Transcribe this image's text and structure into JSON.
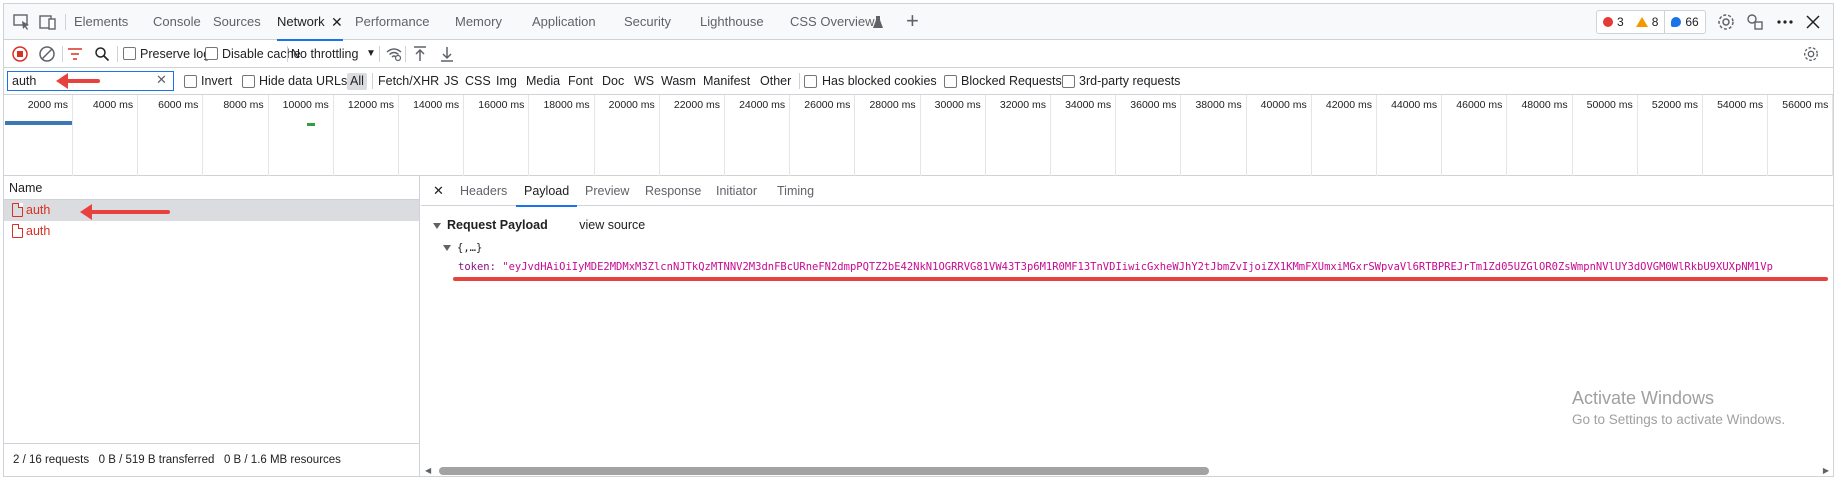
{
  "tabbar": {
    "tabs": [
      "Elements",
      "Console",
      "Sources",
      "Network",
      "Performance",
      "Memory",
      "Application",
      "Security",
      "Lighthouse",
      "CSS Overview"
    ],
    "active_tab": "Network",
    "close_glyph": "✕",
    "plus_glyph": "+",
    "error_count": "3",
    "warning_count": "8",
    "message_count": "66",
    "icons": [
      "inspect-element-icon",
      "device-toolbar-icon",
      "settings-gear-icon",
      "customize-icon",
      "more-options-icon",
      "close-devtools-icon"
    ]
  },
  "toolbar": {
    "preserve_log": "Preserve log",
    "disable_cache": "Disable cache",
    "throttling": "No throttling",
    "dropdown_glyph": "▼"
  },
  "filter": {
    "value": "auth",
    "clear_glyph": "✕",
    "invert": "Invert",
    "hide_data_urls": "Hide data URLs",
    "types": [
      "All",
      "Fetch/XHR",
      "JS",
      "CSS",
      "Img",
      "Media",
      "Font",
      "Doc",
      "WS",
      "Wasm",
      "Manifest",
      "Other"
    ],
    "has_blocked_cookies": "Has blocked cookies",
    "blocked_requests": "Blocked Requests",
    "third_party": "3rd-party requests"
  },
  "timeline": {
    "ticks": [
      "2000 ms",
      "4000 ms",
      "6000 ms",
      "8000 ms",
      "10000 ms",
      "12000 ms",
      "14000 ms",
      "16000 ms",
      "18000 ms",
      "20000 ms",
      "22000 ms",
      "24000 ms",
      "26000 ms",
      "28000 ms",
      "30000 ms",
      "32000 ms",
      "34000 ms",
      "36000 ms",
      "38000 ms",
      "40000 ms",
      "42000 ms",
      "44000 ms",
      "46000 ms",
      "48000 ms",
      "50000 ms",
      "52000 ms",
      "54000 ms",
      "56000 ms"
    ]
  },
  "requests": {
    "column_name": "Name",
    "rows": [
      "auth",
      "auth"
    ],
    "status": "2 / 16 requests   0 B / 519 B transferred   0 B / 1.6 MB resources"
  },
  "details": {
    "close_glyph": "✕",
    "tabs": [
      "Headers",
      "Payload",
      "Preview",
      "Response",
      "Initiator",
      "Timing"
    ],
    "active_tab": "Payload",
    "section_title": "Request Payload",
    "view_source": "view source",
    "object_summary": "{,…}",
    "token_key": "token:",
    "token_value": "\"eyJvdHAiOiIyMDE2MDMxM3ZlcnNJTkQzMTNNV2M3dnFBcURneFN2dmpPQTZ2bE42NkN1OGRRVG81VW43T3p6M1R0MF13TnVDIiwicGxheWJhY2tJbmZvIjoiZX1KMmFXUmxiMGxrSWpvaVl6RTBPREJrTm1Zd05UZGlOR0ZsWmpnNVlUY3dOVGM0WlRkbU9XUXpNM1Vp"
  },
  "watermark": {
    "line1": "Activate Windows",
    "line2": "Go to Settings to activate Windows."
  },
  "colors": {
    "accent": "#1a73e8",
    "error_red": "#d93025",
    "annotation_red": "#e8423f",
    "token_string": "#c80a91"
  }
}
